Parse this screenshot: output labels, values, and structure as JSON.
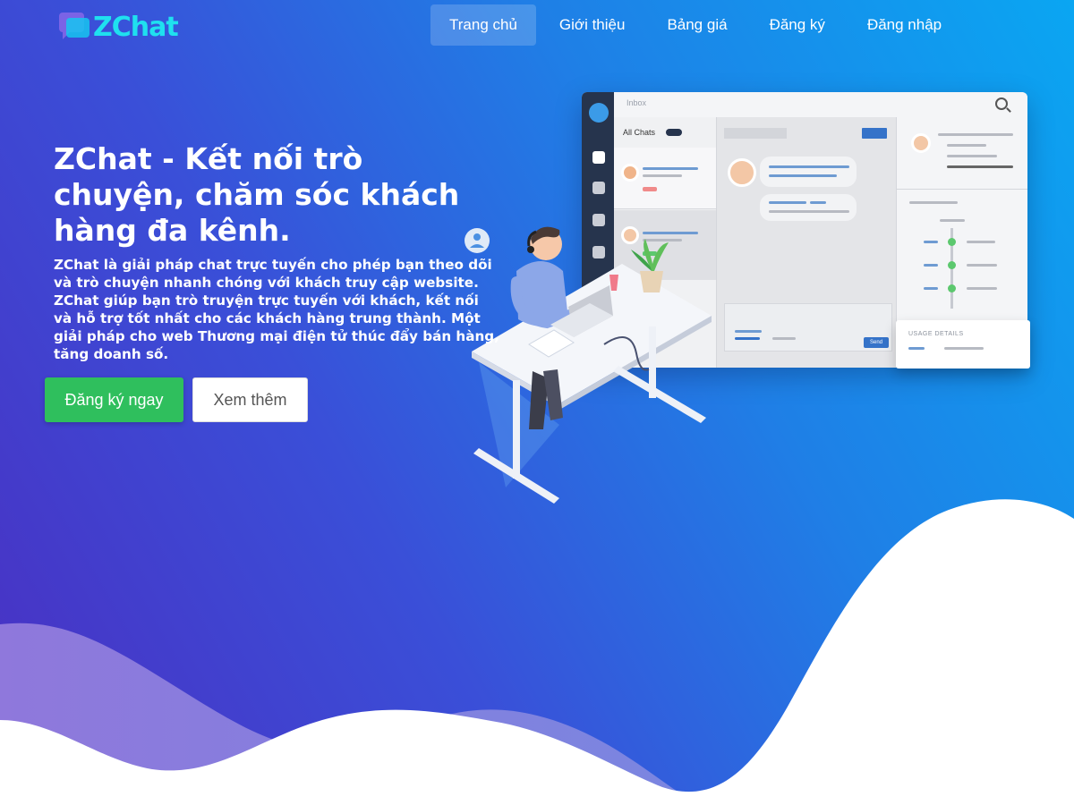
{
  "brand": {
    "name": "ZChat",
    "accent_color": "#1fe0ef",
    "background_start": "#4a2fc2",
    "background_end": "#0aa6f2"
  },
  "nav": {
    "items": [
      {
        "label": "Trang chủ",
        "active": true
      },
      {
        "label": "Giới thiệu",
        "active": false
      },
      {
        "label": "Bảng giá",
        "active": false
      },
      {
        "label": "Đăng ký",
        "active": false
      },
      {
        "label": "Đăng nhập",
        "active": false
      }
    ]
  },
  "hero": {
    "title": "ZChat - Kết nối trò chuyện, chăm sóc khách hàng đa kênh.",
    "description": "ZChat là giải pháp chat trực tuyến cho phép bạn theo dõi và trò chuyện nhanh chóng với khách truy cập website. ZChat giúp bạn trò truyện trực tuyến với khách, kết nối và hỗ trợ tốt nhất cho các khách hàng trung thành. Một giải pháp cho web Thương mại điện tử thúc đẩy bán hàng, tăng doanh số.",
    "primary_button": "Đăng ký ngay",
    "secondary_button": "Xem thêm",
    "primary_color": "#2fbf5d"
  },
  "illustration": {
    "inbox_label": "Inbox",
    "all_chats_label": "All Chats",
    "send_label": "Send",
    "usage_label": "USAGE DETAILS"
  }
}
